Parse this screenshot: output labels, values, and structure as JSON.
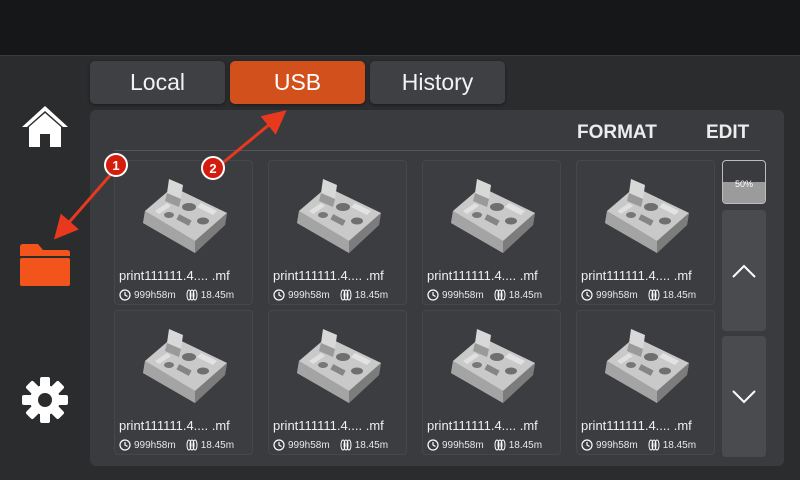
{
  "tabs": [
    {
      "label": "Local",
      "active": false
    },
    {
      "label": "USB",
      "active": true
    },
    {
      "label": "History",
      "active": false
    }
  ],
  "sidebar": {
    "items": [
      {
        "icon": "home-icon",
        "active": false
      },
      {
        "icon": "folder-icon",
        "active": true
      },
      {
        "icon": "gear-icon",
        "active": false
      }
    ]
  },
  "panel": {
    "format_label": "FORMAT",
    "edit_label": "EDIT"
  },
  "files": [
    {
      "name": "print111111.4.... .mf",
      "time": "999h58m",
      "length": "18.45m"
    },
    {
      "name": "print111111.4.... .mf",
      "time": "999h58m",
      "length": "18.45m"
    },
    {
      "name": "print111111.4.... .mf",
      "time": "999h58m",
      "length": "18.45m"
    },
    {
      "name": "print111111.4.... .mf",
      "time": "999h58m",
      "length": "18.45m"
    },
    {
      "name": "print111111.4.... .mf",
      "time": "999h58m",
      "length": "18.45m"
    },
    {
      "name": "print111111.4.... .mf",
      "time": "999h58m",
      "length": "18.45m"
    },
    {
      "name": "print111111.4.... .mf",
      "time": "999h58m",
      "length": "18.45m"
    },
    {
      "name": "print111111.4.... .mf",
      "time": "999h58m",
      "length": "18.45m"
    }
  ],
  "scroll": {
    "percent_label": "50%",
    "percent": 0.5
  },
  "annotations": [
    {
      "label": "1"
    },
    {
      "label": "2"
    }
  ],
  "colors": {
    "accent": "#d2501c",
    "annotation": "#d51d0e",
    "background": "#2b2c2e",
    "panel": "#3a3b3e"
  }
}
